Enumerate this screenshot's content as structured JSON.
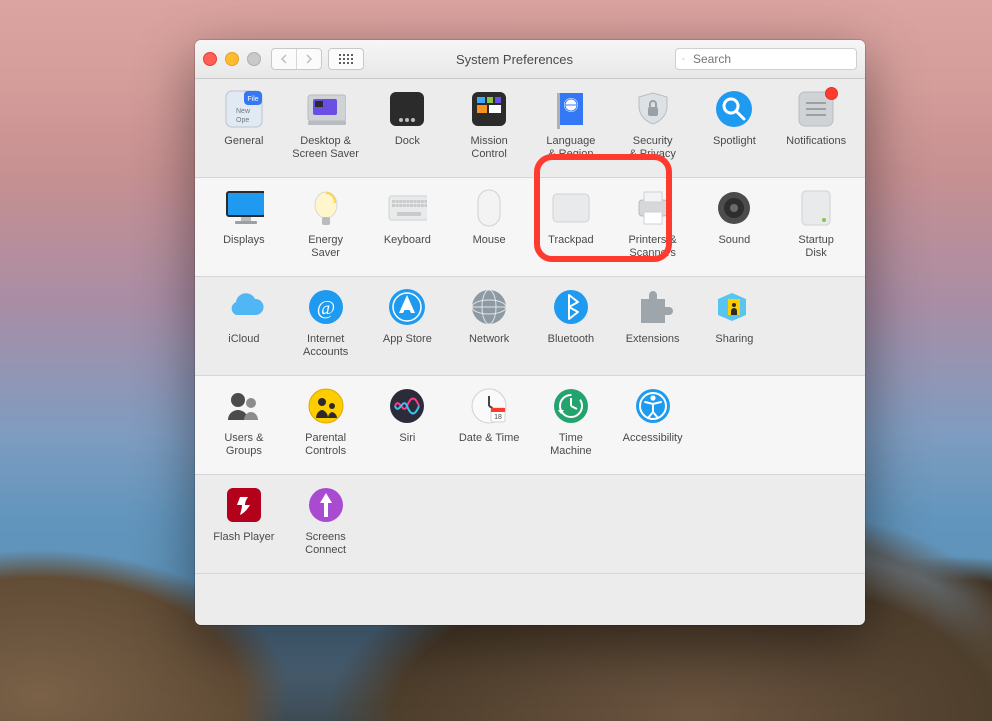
{
  "window": {
    "title": "System Preferences"
  },
  "search": {
    "placeholder": "Search"
  },
  "sections": [
    {
      "alt": false,
      "items": [
        {
          "name": "general",
          "label": "General",
          "icon": "general"
        },
        {
          "name": "desktop-screensaver",
          "label": "Desktop &\nScreen Saver",
          "icon": "desktop"
        },
        {
          "name": "dock",
          "label": "Dock",
          "icon": "dock"
        },
        {
          "name": "mission-control",
          "label": "Mission\nControl",
          "icon": "mission"
        },
        {
          "name": "language-region",
          "label": "Language\n& Region",
          "icon": "language"
        },
        {
          "name": "security-privacy",
          "label": "Security\n& Privacy",
          "icon": "security"
        },
        {
          "name": "spotlight",
          "label": "Spotlight",
          "icon": "spotlight"
        },
        {
          "name": "notifications",
          "label": "Notifications",
          "icon": "notifications",
          "badge": true
        }
      ]
    },
    {
      "alt": true,
      "items": [
        {
          "name": "displays",
          "label": "Displays",
          "icon": "displays"
        },
        {
          "name": "energy-saver",
          "label": "Energy\nSaver",
          "icon": "energy"
        },
        {
          "name": "keyboard",
          "label": "Keyboard",
          "icon": "keyboard"
        },
        {
          "name": "mouse",
          "label": "Mouse",
          "icon": "mouse"
        },
        {
          "name": "trackpad",
          "label": "Trackpad",
          "icon": "trackpad"
        },
        {
          "name": "printers-scanners",
          "label": "Printers &\nScanners",
          "icon": "printers"
        },
        {
          "name": "sound",
          "label": "Sound",
          "icon": "sound"
        },
        {
          "name": "startup-disk",
          "label": "Startup\nDisk",
          "icon": "startupdisk"
        }
      ]
    },
    {
      "alt": false,
      "items": [
        {
          "name": "icloud",
          "label": "iCloud",
          "icon": "icloud"
        },
        {
          "name": "internet-accounts",
          "label": "Internet\nAccounts",
          "icon": "internet"
        },
        {
          "name": "app-store",
          "label": "App Store",
          "icon": "appstore",
          "highlight": true
        },
        {
          "name": "network",
          "label": "Network",
          "icon": "network"
        },
        {
          "name": "bluetooth",
          "label": "Bluetooth",
          "icon": "bluetooth"
        },
        {
          "name": "extensions",
          "label": "Extensions",
          "icon": "extensions"
        },
        {
          "name": "sharing",
          "label": "Sharing",
          "icon": "sharing"
        }
      ]
    },
    {
      "alt": true,
      "items": [
        {
          "name": "users-groups",
          "label": "Users &\nGroups",
          "icon": "users"
        },
        {
          "name": "parental-controls",
          "label": "Parental\nControls",
          "icon": "parental"
        },
        {
          "name": "siri",
          "label": "Siri",
          "icon": "siri"
        },
        {
          "name": "date-time",
          "label": "Date & Time",
          "icon": "datetime"
        },
        {
          "name": "time-machine",
          "label": "Time\nMachine",
          "icon": "timemachine"
        },
        {
          "name": "accessibility",
          "label": "Accessibility",
          "icon": "accessibility"
        }
      ]
    },
    {
      "alt": false,
      "items": [
        {
          "name": "flash-player",
          "label": "Flash Player",
          "icon": "flash"
        },
        {
          "name": "screens-connect",
          "label": "Screens\nConnect",
          "icon": "screensconnect"
        }
      ]
    }
  ]
}
